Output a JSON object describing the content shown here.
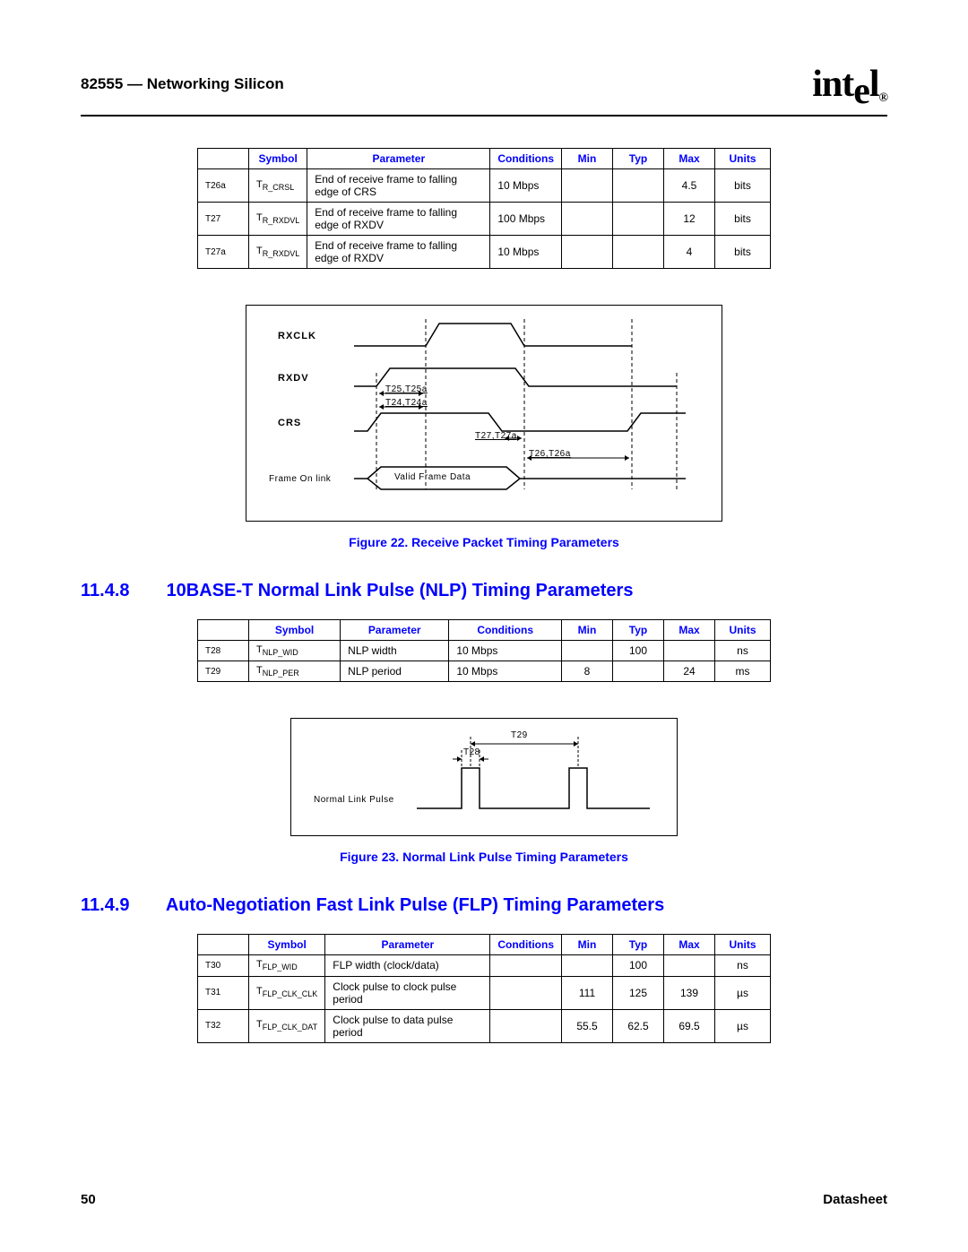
{
  "header": {
    "title": "82555 — Networking Silicon",
    "logo": "intel",
    "page_number": "50",
    "footer_label": "Datasheet"
  },
  "table1": {
    "headers": [
      "",
      "Symbol",
      "Parameter",
      "Conditions",
      "Min",
      "Typ",
      "Max",
      "Units"
    ],
    "rows": [
      {
        "id": "T26a",
        "sym_pre": "T",
        "sym_sub": "R_CRSL",
        "param": "End of receive frame to falling edge of CRS",
        "cond": "10 Mbps",
        "min": "",
        "typ": "",
        "max": "4.5",
        "units": "bits"
      },
      {
        "id": "T27",
        "sym_pre": "T",
        "sym_sub": "R_RXDVL",
        "param": "End of receive frame to falling edge of RXDV",
        "cond": "100 Mbps",
        "min": "",
        "typ": "",
        "max": "12",
        "units": "bits"
      },
      {
        "id": "T27a",
        "sym_pre": "T",
        "sym_sub": "R_RXDVL",
        "param": "End of receive frame to falling edge of RXDV",
        "cond": "10 Mbps",
        "min": "",
        "typ": "",
        "max": "4",
        "units": "bits"
      }
    ]
  },
  "fig22": {
    "caption": "Figure 22. Receive Packet Timing Parameters",
    "labels": {
      "rxclk": "RXCLK",
      "rxdv": "RXDV",
      "crs": "CRS",
      "frame": "Frame On link",
      "valid": "Valid Frame Data",
      "t25": "T25,T25a",
      "t24": "T24,T24a",
      "t27": "T27,T27a",
      "t26": "T26,T26a"
    }
  },
  "section1": {
    "number": "11.4.8",
    "title": "10BASE-T Normal Link Pulse (NLP) Timing Parameters"
  },
  "table2": {
    "headers": [
      "",
      "Symbol",
      "Parameter",
      "Conditions",
      "Min",
      "Typ",
      "Max",
      "Units"
    ],
    "rows": [
      {
        "id": "T28",
        "sym_pre": "T",
        "sym_sub": "NLP_WID",
        "param": "NLP width",
        "cond": "10 Mbps",
        "min": "",
        "typ": "100",
        "max": "",
        "units": "ns"
      },
      {
        "id": "T29",
        "sym_pre": "T",
        "sym_sub": "NLP_PER",
        "param": "NLP period",
        "cond": "10 Mbps",
        "min": "8",
        "typ": "",
        "max": "24",
        "units": "ms"
      }
    ]
  },
  "fig23": {
    "caption": "Figure 23. Normal Link Pulse Timing Parameters",
    "labels": {
      "nlp": "Normal Link Pulse",
      "t28": "T28",
      "t29": "T29"
    }
  },
  "section2": {
    "number": "11.4.9",
    "title": "Auto-Negotiation Fast Link Pulse (FLP) Timing Parameters"
  },
  "table3": {
    "headers": [
      "",
      "Symbol",
      "Parameter",
      "Conditions",
      "Min",
      "Typ",
      "Max",
      "Units"
    ],
    "rows": [
      {
        "id": "T30",
        "sym_pre": "T",
        "sym_sub": "FLP_WID",
        "param": "FLP width (clock/data)",
        "cond": "",
        "min": "",
        "typ": "100",
        "max": "",
        "units": "ns"
      },
      {
        "id": "T31",
        "sym_pre": "T",
        "sym_sub": "FLP_CLK_CLK",
        "param": "Clock pulse to clock pulse period",
        "cond": "",
        "min": "111",
        "typ": "125",
        "max": "139",
        "units": "µs"
      },
      {
        "id": "T32",
        "sym_pre": "T",
        "sym_sub": "FLP_CLK_DAT",
        "param": "Clock pulse to data pulse period",
        "cond": "",
        "min": "55.5",
        "typ": "62.5",
        "max": "69.5",
        "units": "µs"
      }
    ]
  }
}
